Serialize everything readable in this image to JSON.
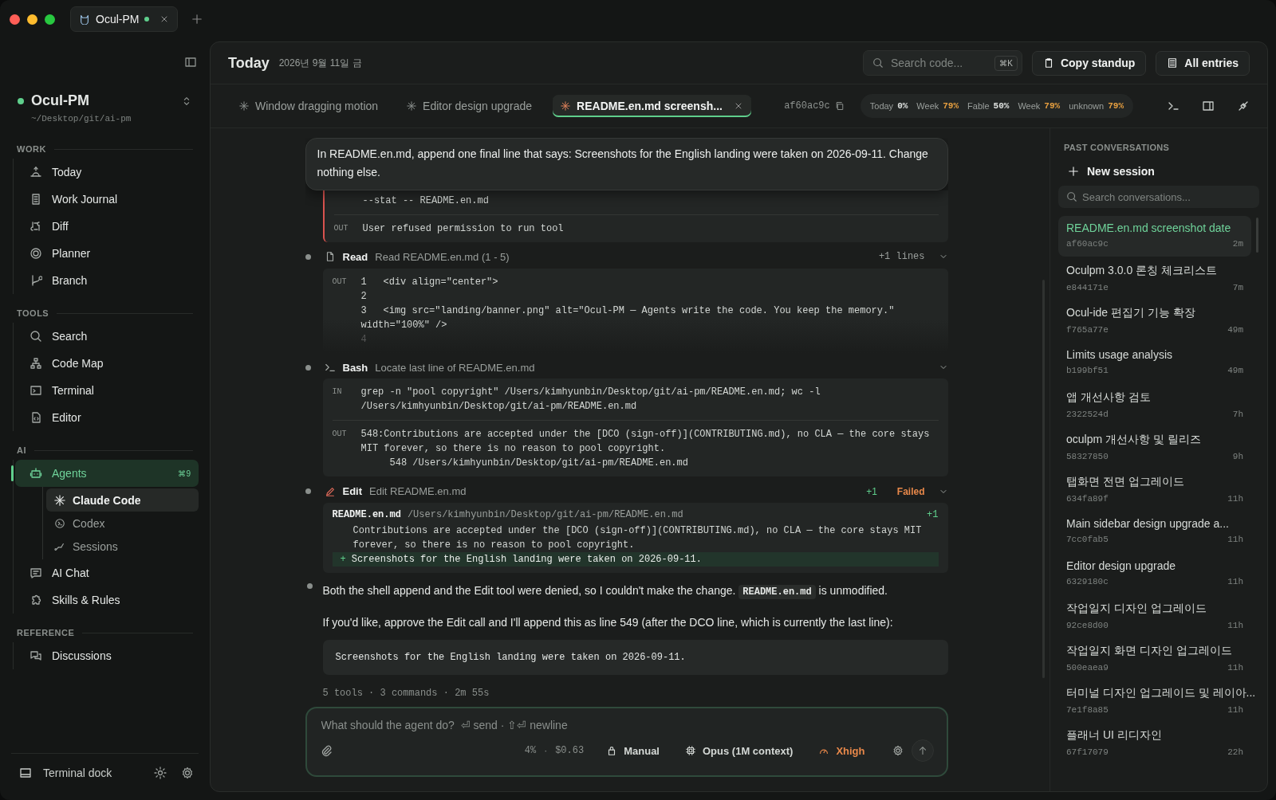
{
  "window": {
    "tab": {
      "label": "Ocul-PM",
      "live": true
    }
  },
  "sidebar": {
    "project": {
      "name": "Ocul-PM",
      "path": "~/Desktop/git/ai-pm",
      "online": true
    },
    "sections": [
      {
        "title": "WORK",
        "items": [
          {
            "label": "Today",
            "selected": false
          },
          {
            "label": "Work Journal",
            "selected": false
          },
          {
            "label": "Diff",
            "selected": false
          },
          {
            "label": "Planner",
            "selected": false
          },
          {
            "label": "Branch",
            "selected": false
          }
        ]
      },
      {
        "title": "TOOLS",
        "items": [
          {
            "label": "Search",
            "selected": false
          },
          {
            "label": "Code Map",
            "selected": false
          },
          {
            "label": "Terminal",
            "selected": false
          },
          {
            "label": "Editor",
            "selected": false
          }
        ]
      },
      {
        "title": "AI",
        "items": [
          {
            "label": "Agents",
            "selected": true,
            "shortcut": "⌘9",
            "children": [
              {
                "label": "Claude Code",
                "selected": true
              },
              {
                "label": "Codex",
                "selected": false
              },
              {
                "label": "Sessions",
                "selected": false
              }
            ]
          },
          {
            "label": "AI Chat",
            "selected": false
          },
          {
            "label": "Skills & Rules",
            "selected": false
          }
        ]
      },
      {
        "title": "REFERENCE",
        "items": [
          {
            "label": "Discussions",
            "selected": false
          }
        ]
      }
    ],
    "footer": {
      "label": "Terminal dock"
    }
  },
  "header": {
    "title": "Today",
    "date": "2026년 9월 11일 금",
    "search": {
      "placeholder": "Search code...",
      "shortcut": "⌘K"
    },
    "buttons": [
      "Copy standup",
      "All entries"
    ]
  },
  "session_tabs": [
    {
      "label": "Window dragging motion",
      "selected": false
    },
    {
      "label": "Editor design upgrade",
      "selected": false
    },
    {
      "label": "README.en.md screensh...",
      "selected": true
    }
  ],
  "commit": "af60ac9c",
  "usage": [
    {
      "label": "Today",
      "value": "0%",
      "warning": false
    },
    {
      "label": "Week",
      "value": "79%",
      "warning": true
    },
    {
      "label": "Fable",
      "value": "50%",
      "warning": false
    },
    {
      "label": "Week",
      "value": "79%",
      "warning": true
    },
    {
      "label": "unknown",
      "value": "79%",
      "warning": true
    }
  ],
  "prompt": "In README.en.md, append one final line that says: Screenshots for the English landing were taken on 2026-09-11. Change nothing else.",
  "transcript": [
    {
      "kind": "output",
      "failed": true,
      "in": [
        "--stat -- README.en.md"
      ],
      "out_label": "OUT",
      "out": [
        "User refused permission to run tool"
      ]
    },
    {
      "kind": "read",
      "tool": "Read",
      "desc": "Read README.en.md (1 - 5)",
      "meta": "+1 lines",
      "out_label": "OUT",
      "lines": [
        {
          "num": "1",
          "text": "<div align=\"center\">"
        },
        {
          "num": "2"
        },
        {
          "num": "3",
          "text": "<img src=\"landing/banner.png\" alt=\"Ocul-PM — Agents write the code. You keep the memory.\"",
          "wrap": "width=\"100%\" />"
        },
        {
          "num": "4"
        }
      ]
    },
    {
      "kind": "bash",
      "tool": "Bash",
      "desc": "Locate last line of README.en.md",
      "in_label": "IN",
      "out_label": "OUT",
      "in": [
        "grep -n \"pool copyright\" /Users/kimhyunbin/Desktop/git/ai-pm/README.en.md; wc -l",
        "/Users/kimhyunbin/Desktop/git/ai-pm/README.en.md"
      ],
      "out": [
        "548:Contributions are accepted under the [DCO (sign-off)](CONTRIBUTING.md), no CLA — the core stays",
        "MIT forever, so there is no reason to pool copyright.",
        "     548 /Users/kimhyunbin/Desktop/git/ai-pm/README.en.md"
      ]
    },
    {
      "kind": "edit",
      "tool": "Edit",
      "desc": "Edit README.en.md",
      "added": "+1",
      "status": "Failed",
      "file": "README.en.md",
      "path": "/Users/kimhyunbin/Desktop/git/ai-pm/README.en.md",
      "count": "+1",
      "context": [
        "Contributions are accepted under the [DCO (sign-off)](CONTRIBUTING.md), no CLA — the core stays MIT",
        "forever, so there is no reason to pool copyright."
      ],
      "marker": "+",
      "new_line": "Screenshots for the English landing were taken on 2026-09-11."
    },
    {
      "kind": "message",
      "before": "Both the shell append and the Edit tool were denied, so I couldn't make the change.",
      "code": "README.en.md",
      "after": "is unmodified.",
      "next": "If you'd like, approve the Edit call and I'll append this as line 549 (after the DCO line, which is currently the last line):"
    },
    {
      "kind": "code",
      "text": "Screenshots for the English landing were taken on 2026-09-11."
    },
    {
      "kind": "summary",
      "text": "5 tools · 3 commands · 2m 55s"
    }
  ],
  "composer": {
    "placeholder": "What should the agent do?  ⏎ send · ⇧⏎ newline",
    "context": "4%",
    "separator": "·",
    "cost": "$0.63",
    "mode": "Manual",
    "model": "Opus (1M context)",
    "effort": "Xhigh"
  },
  "past": {
    "title": "PAST CONVERSATIONS",
    "new_label": "New session",
    "search_placeholder": "Search conversations...",
    "items": [
      {
        "title": "README.en.md screenshot date",
        "id": "af60ac9c",
        "age": "2m",
        "selected": true
      },
      {
        "title": "Oculpm 3.0.0 론칭 체크리스트",
        "id": "e844171e",
        "age": "7m",
        "selected": false
      },
      {
        "title": "Ocul-ide 편집기 기능 확장",
        "id": "f765a77e",
        "age": "49m",
        "selected": false
      },
      {
        "title": "Limits usage analysis",
        "id": "b199bf51",
        "age": "49m",
        "selected": false
      },
      {
        "title": "앱 개선사항 검토",
        "id": "2322524d",
        "age": "7h",
        "selected": false
      },
      {
        "title": "oculpm 개선사항 및 릴리즈",
        "id": "58327850",
        "age": "9h",
        "selected": false
      },
      {
        "title": "탭화면 전면 업그레이드",
        "id": "634fa89f",
        "age": "11h",
        "selected": false
      },
      {
        "title": "Main sidebar design upgrade a...",
        "id": "7cc0fab5",
        "age": "11h",
        "selected": false
      },
      {
        "title": "Editor design upgrade",
        "id": "6329180c",
        "age": "11h",
        "selected": false
      },
      {
        "title": "작업일지 디자인 업그레이드",
        "id": "92ce8d00",
        "age": "11h",
        "selected": false
      },
      {
        "title": "작업일지 화면 디자인 업그레이드",
        "id": "500eaea9",
        "age": "11h",
        "selected": false
      },
      {
        "title": "터미널 디자인 업그레이드 및 레이아...",
        "id": "7e1f8a85",
        "age": "11h",
        "selected": false
      },
      {
        "title": "플래너 UI 리디자인",
        "id": "67f17079",
        "age": "22h",
        "selected": false
      }
    ]
  }
}
